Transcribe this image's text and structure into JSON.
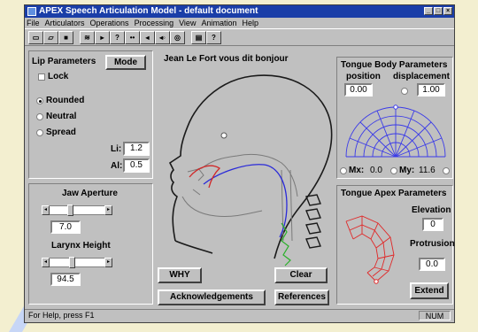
{
  "window": {
    "title": "APEX Speech Articulation Model - default document",
    "title_buttons": [
      "_",
      "□",
      "×"
    ]
  },
  "menu": [
    "File",
    "Articulators",
    "Operations",
    "Processing",
    "View",
    "Animation",
    "Help"
  ],
  "toolbar": {
    "buttons": [
      {
        "icon": "new-document-icon",
        "glyph": "▭"
      },
      {
        "icon": "open-folder-icon",
        "glyph": "▱"
      },
      {
        "icon": "save-disk-icon",
        "glyph": "■"
      },
      {
        "icon": "waveform-icon",
        "glyph": "≋"
      },
      {
        "icon": "play-icon",
        "glyph": "▸"
      },
      {
        "icon": "question-icon",
        "glyph": "?"
      },
      {
        "icon": "step-forward-icon",
        "glyph": "••"
      },
      {
        "icon": "step-back-icon",
        "glyph": "◂"
      },
      {
        "icon": "sound-icon",
        "glyph": "◂◦"
      },
      {
        "icon": "record-icon",
        "glyph": "◎"
      },
      {
        "icon": "printer-icon",
        "glyph": "▤"
      },
      {
        "icon": "help-icon",
        "glyph": "?"
      }
    ]
  },
  "lip": {
    "title": "Lip Parameters",
    "mode_button": "Mode",
    "lock_label": "Lock",
    "options": [
      "Rounded",
      "Neutral",
      "Spread"
    ],
    "selected": "Rounded",
    "li_label": "Li:",
    "li_value": "1.2",
    "al_label": "Al:",
    "al_value": "0.5"
  },
  "jaw": {
    "title": "Jaw Aperture",
    "value": "7.0",
    "level": 0.35
  },
  "larynx": {
    "title": "Larynx Height",
    "value": "94.5",
    "level": 0.4
  },
  "center": {
    "utterance": "Jean Le Fort vous dit bonjour",
    "why_button": "WHY",
    "clear_button": "Clear",
    "ack_button": "Acknowledgements",
    "ref_button": "References"
  },
  "tongue_body": {
    "title": "Tongue Body Parameters",
    "position_label": "position",
    "displacement_label": "displacement",
    "position_value": "0.00",
    "displacement_value": "1.00",
    "mx_label": "Mx:",
    "mx_value": "0.0",
    "my_label": "My:",
    "my_value": "11.6"
  },
  "tongue_apex": {
    "title": "Tongue Apex Parameters",
    "elevation_label": "Elevation",
    "elevation_value": "0",
    "protrusion_label": "Protrusion",
    "protrusion_value": "0.0",
    "extend_button": "Extend"
  },
  "status": {
    "help_text": "For Help, press F1",
    "indicator": "NUM"
  },
  "colors": {
    "titlebar": "#1a3ea8",
    "body_grid": "#3a3ae8",
    "apex_grid": "#e02828",
    "outline": "#1a1a1a",
    "tongue": "#2a2ad8",
    "lip_curve": "#d02828",
    "larynx": "#28b028"
  }
}
